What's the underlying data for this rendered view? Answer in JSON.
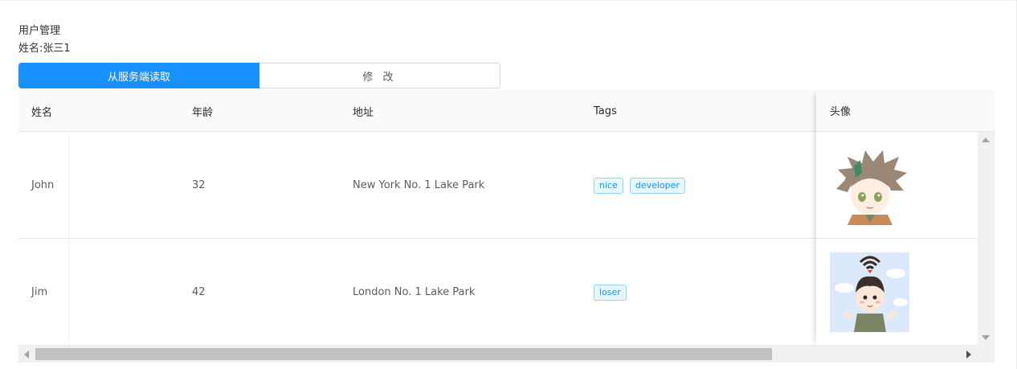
{
  "header": {
    "title": "用户管理",
    "user_label": "姓名:张三1"
  },
  "actions": {
    "load_label": "从服务端读取",
    "edit_label": "修 改"
  },
  "table": {
    "columns": [
      "姓名",
      "年龄",
      "地址",
      "Tags",
      "头像"
    ],
    "rows": [
      {
        "name": "John",
        "age": "32",
        "address": "New York No. 1 Lake Park",
        "tags": [
          "nice",
          "developer"
        ],
        "avatar": "anime-boy-avatar"
      },
      {
        "name": "Jim",
        "age": "42",
        "address": "London No. 1 Lake Park",
        "tags": [
          "loser"
        ],
        "avatar": "cartoon-boy-wifi-avatar"
      }
    ]
  },
  "colors": {
    "primary": "#1890ff",
    "tag_bg": "#e6f7ff",
    "tag_border": "#91d5ff"
  }
}
